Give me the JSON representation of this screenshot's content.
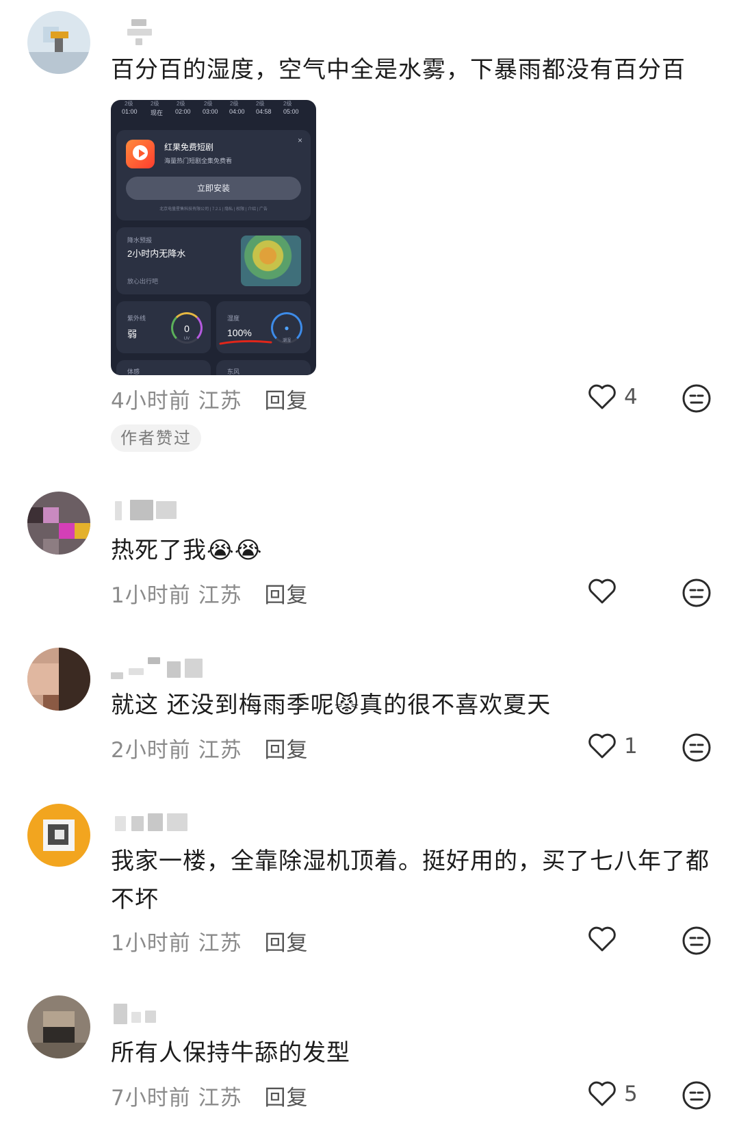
{
  "comments": [
    {
      "text": "百分百的湿度，空气中全是水雾，下暴雨都没有百分百",
      "time": "4小时前",
      "location": "江苏",
      "reply": "回复",
      "likes": "4",
      "author_badge": "作者赞过",
      "image": {
        "hours": [
          "01:00",
          "现在",
          "02:00",
          "03:00",
          "04:00",
          "04:58",
          "05:00"
        ],
        "hour_level": "2级",
        "ad": {
          "title": "红果免费短剧",
          "subtitle": "海量热门短剧全集免费看",
          "button": "立即安装",
          "close": "×",
          "footer": "北京电量星售科技有限公司 | 7.2.1 | 隐私 | 权限 | 介绍 | 广告"
        },
        "rain": {
          "label": "降水预报",
          "main": "2小时内无降水",
          "sub": "放心出行吧"
        },
        "uv": {
          "label": "紫外线",
          "value": "弱",
          "gauge": "0",
          "gauge_unit": "UV"
        },
        "humidity": {
          "label": "湿度",
          "value": "100%",
          "gauge_unit": "潮湿"
        },
        "bottom_labels": [
          "体感",
          "东风"
        ]
      }
    },
    {
      "text": "热死了我",
      "time": "1小时前",
      "location": "江苏",
      "reply": "回复",
      "likes": ""
    },
    {
      "text": "就这 还没到梅雨季呢",
      "text2": "真的很不喜欢夏天",
      "time": "2小时前",
      "location": "江苏",
      "reply": "回复",
      "likes": "1"
    },
    {
      "text": "我家一楼，全靠除湿机顶着。挺好用的，买了七八年了都",
      "text_line2": "不坏",
      "time": "1小时前",
      "location": "江苏",
      "reply": "回复",
      "likes": ""
    },
    {
      "text": "所有人保持牛舔的发型",
      "time": "7小时前",
      "location": "江苏",
      "reply": "回复",
      "likes": "5"
    }
  ],
  "icons": {
    "like": "heart-outline-icon",
    "react": "neutral-face-icon"
  },
  "colors": {
    "meta_gray": "#8a8a8a",
    "humidity_underline": "#e0261a"
  }
}
